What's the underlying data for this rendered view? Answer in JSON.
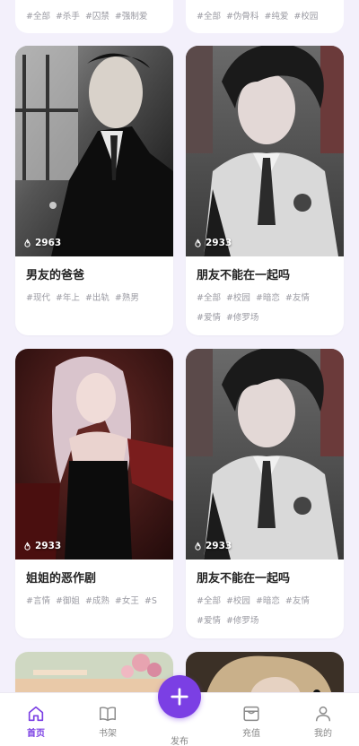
{
  "top_row": [
    {
      "tags": [
        "#全部",
        "#杀手",
        "#囚禁",
        "#强制爱"
      ]
    },
    {
      "tags": [
        "#全部",
        "#伪骨科",
        "#纯爱",
        "#校园"
      ]
    }
  ],
  "cards": [
    {
      "title": "男友的爸爸",
      "heat": "2963",
      "tags": [
        "#现代",
        "#年上",
        "#出轨",
        "#熟男"
      ],
      "art": "suit-man"
    },
    {
      "title": "朋友不能在一起吗",
      "heat": "2933",
      "tags": [
        "#全部",
        "#校园",
        "#暗恋",
        "#友情",
        "#爱情",
        "#修罗场"
      ],
      "art": "school-boy"
    },
    {
      "title": "姐姐的恶作剧",
      "heat": "2933",
      "tags": [
        "#言情",
        "#御姐",
        "#成熟",
        "#女王",
        "#S"
      ],
      "art": "dark-lady"
    },
    {
      "title": "朋友不能在一起吗",
      "heat": "2933",
      "tags": [
        "#全部",
        "#校园",
        "#暗恋",
        "#友情",
        "#爱情",
        "#修罗场"
      ],
      "art": "school-boy"
    }
  ],
  "bottom_row": [
    {
      "art": "garden-scene"
    },
    {
      "art": "blond-boy"
    }
  ],
  "tabbar": {
    "items": [
      {
        "label": "首页",
        "icon": "home-icon",
        "active": true
      },
      {
        "label": "书架",
        "icon": "book-icon",
        "active": false
      },
      {
        "label": "发布",
        "icon": "plus-icon",
        "active": false
      },
      {
        "label": "充值",
        "icon": "wallet-icon",
        "active": false
      },
      {
        "label": "我的",
        "icon": "user-icon",
        "active": false
      }
    ],
    "accent": "#7b3fe4"
  },
  "colors": {
    "background": "#f3f0fb",
    "tag": "#9a9aa2",
    "title": "#222222"
  }
}
